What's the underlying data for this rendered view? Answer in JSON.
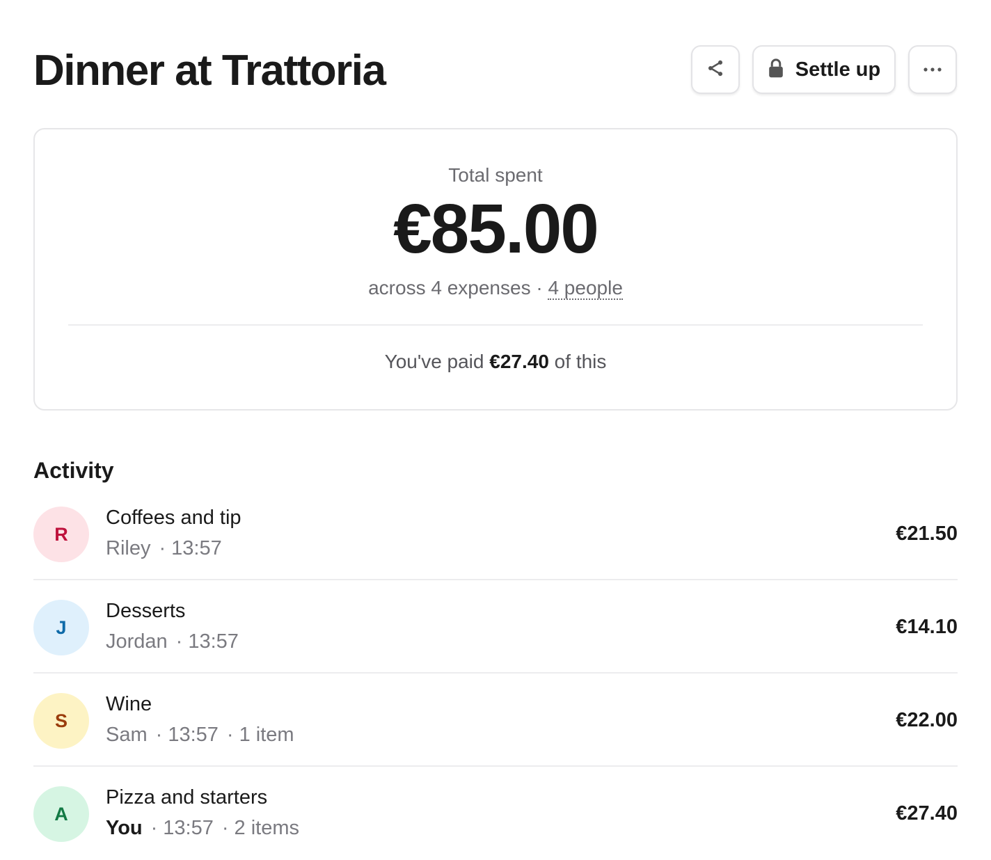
{
  "header": {
    "title": "Dinner at Trattoria",
    "settle_label": "Settle up",
    "icons": {
      "share": "share-icon",
      "lock": "lock-icon",
      "more": "more-horizontal-icon"
    }
  },
  "summary": {
    "label": "Total spent",
    "total": "€85.00",
    "sub_prefix": "across 4 expenses · ",
    "people_link": "4 people",
    "paid_prefix": "You've paid ",
    "paid_amount": "€27.40",
    "paid_suffix": " of this"
  },
  "activity": {
    "title": "Activity",
    "items": [
      {
        "initial": "R",
        "title": "Coffees and tip",
        "who": "Riley",
        "time": "13:57",
        "count": "",
        "amount": "€21.50",
        "avatar_bg": "#fde2e6",
        "avatar_fg": "#be123c",
        "is_me": false
      },
      {
        "initial": "J",
        "title": "Desserts",
        "who": "Jordan",
        "time": "13:57",
        "count": "",
        "amount": "€14.10",
        "avatar_bg": "#dff0fc",
        "avatar_fg": "#0e6aa8",
        "is_me": false
      },
      {
        "initial": "S",
        "title": "Wine",
        "who": "Sam",
        "time": "13:57",
        "count": "1 item",
        "amount": "€22.00",
        "avatar_bg": "#fdf3c4",
        "avatar_fg": "#9a3c0c",
        "is_me": false
      },
      {
        "initial": "A",
        "title": "Pizza and starters",
        "who": "You",
        "time": "13:57",
        "count": "2 items",
        "amount": "€27.40",
        "avatar_bg": "#d6f5e3",
        "avatar_fg": "#137a45",
        "is_me": true
      }
    ]
  },
  "colors": {
    "text": "#1a1a1a",
    "muted": "#6b6b70",
    "border": "#e6e6e8"
  }
}
